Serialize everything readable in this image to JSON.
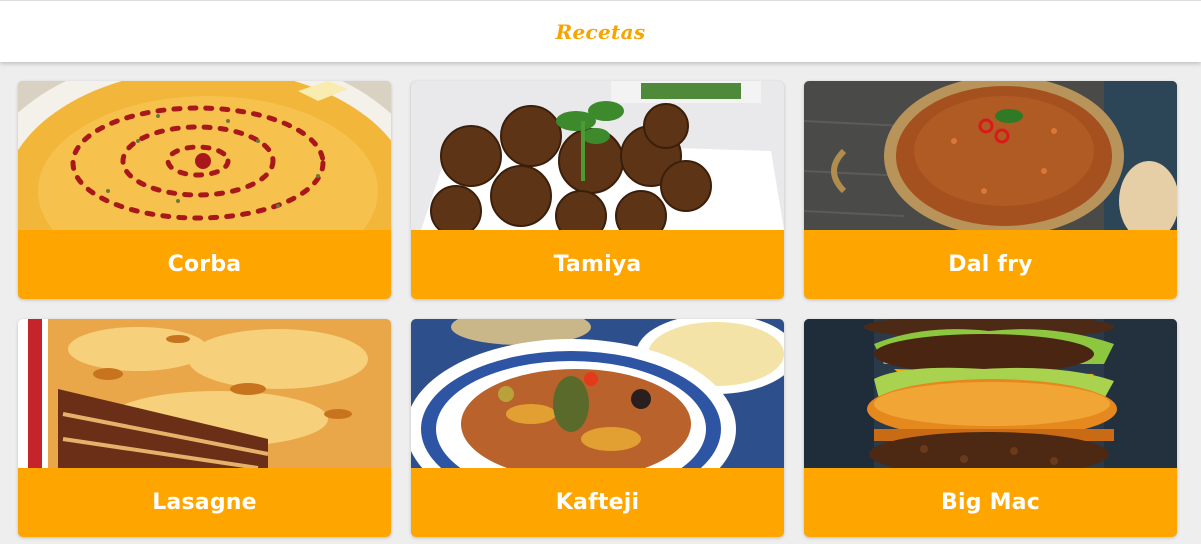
{
  "header": {
    "title": "Recetas"
  },
  "recipes": [
    {
      "name": "Corba",
      "image": "lentil-soup-photo"
    },
    {
      "name": "Tamiya",
      "image": "falafel-photo"
    },
    {
      "name": "Dal fry",
      "image": "dal-fry-photo"
    },
    {
      "name": "Lasagne",
      "image": "lasagne-photo"
    },
    {
      "name": "Kafteji",
      "image": "kafteji-photo"
    },
    {
      "name": "Big Mac",
      "image": "burger-photo"
    }
  ],
  "colors": {
    "accent": "#ffa500",
    "brand": "#f7a400",
    "background": "#eeeeee"
  }
}
